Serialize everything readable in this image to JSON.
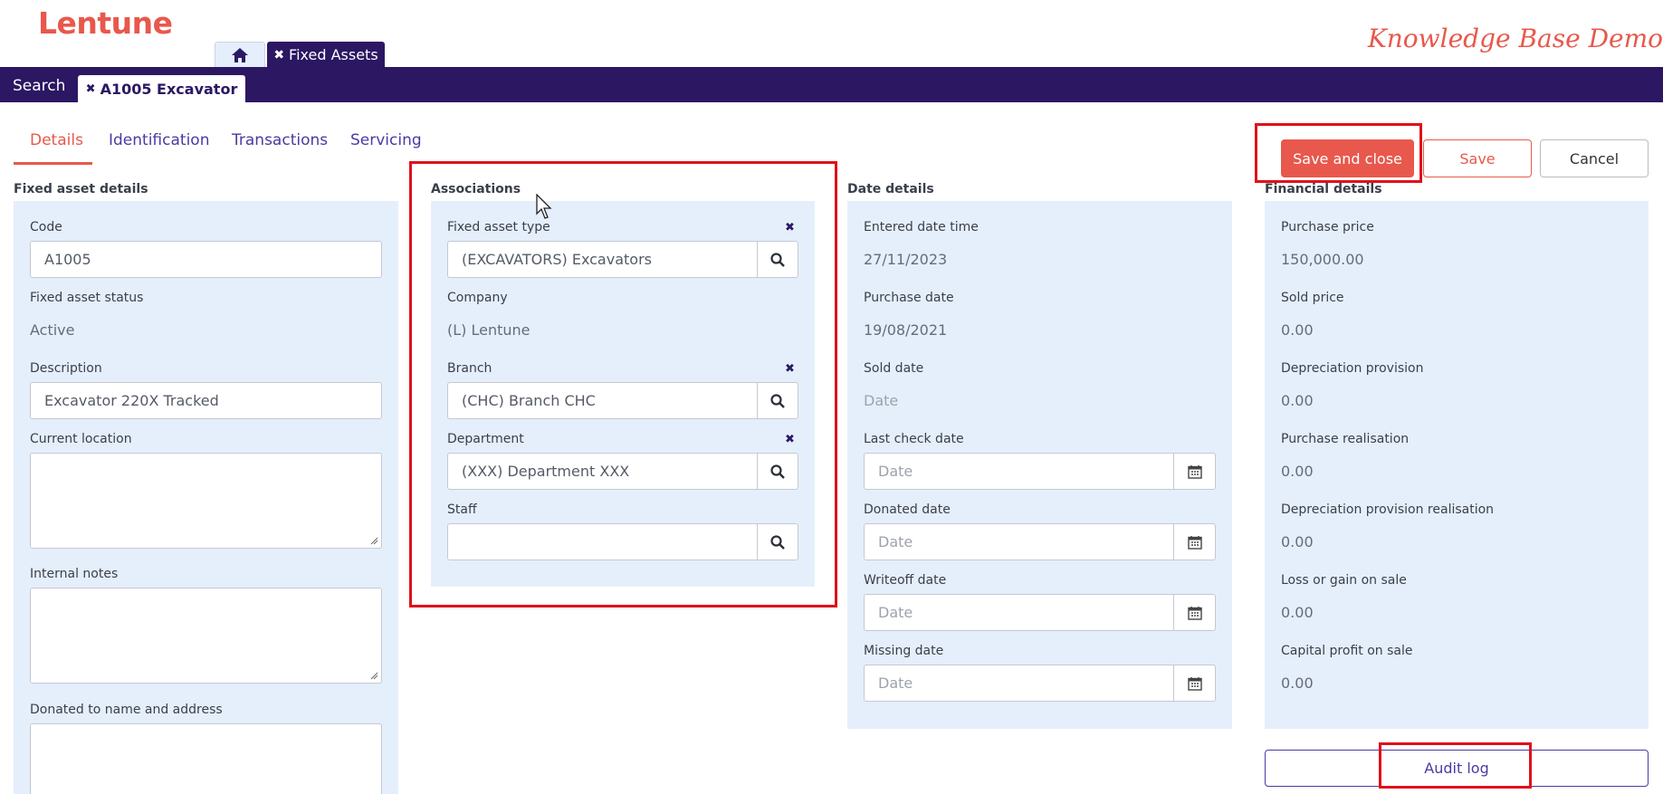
{
  "header": {
    "logo": "Lentune",
    "brand_tagline": "Knowledge Base Demo",
    "top_tabs": [
      {
        "icon": "home-icon"
      },
      {
        "icon": "close-icon",
        "label": "Fixed Assets"
      }
    ]
  },
  "navbar": {
    "search_label": "Search",
    "record_tab_label": "A1005 Excavator"
  },
  "subtabs": {
    "details": "Details",
    "identification": "Identification",
    "transactions": "Transactions",
    "servicing": "Servicing"
  },
  "actions": {
    "save_and_close": "Save and close",
    "save": "Save",
    "cancel": "Cancel",
    "audit_log": "Audit log"
  },
  "fixed_asset_details": {
    "title": "Fixed asset details",
    "code_label": "Code",
    "code_value": "A1005",
    "status_label": "Fixed asset status",
    "status_value": "Active",
    "description_label": "Description",
    "description_value": "Excavator 220X Tracked",
    "location_label": "Current location",
    "notes_label": "Internal notes",
    "donated_to_label": "Donated to name and address"
  },
  "associations": {
    "title": "Associations",
    "type_label": "Fixed asset type",
    "type_value": "(EXCAVATORS) Excavators",
    "company_label": "Company",
    "company_value": "(L) Lentune",
    "branch_label": "Branch",
    "branch_value": "(CHC) Branch CHC",
    "department_label": "Department",
    "department_value": "(XXX) Department XXX",
    "staff_label": "Staff",
    "staff_value": ""
  },
  "date_details": {
    "title": "Date details",
    "entered_label": "Entered date time",
    "entered_value": "27/11/2023",
    "purchase_label": "Purchase date",
    "purchase_value": "19/08/2021",
    "sold_label": "Sold date",
    "sold_value": "Date",
    "last_check_label": "Last check date",
    "donated_label": "Donated date",
    "writeoff_label": "Writeoff date",
    "missing_label": "Missing date",
    "date_placeholder": "Date"
  },
  "financial_details": {
    "title": "Financial details",
    "purchase_price_label": "Purchase price",
    "purchase_price_value": "150,000.00",
    "sold_price_label": "Sold price",
    "sold_price_value": "0.00",
    "dep_provision_label": "Depreciation provision",
    "dep_provision_value": "0.00",
    "purchase_realisation_label": "Purchase realisation",
    "purchase_realisation_value": "0.00",
    "dep_realisation_label": "Depreciation provision realisation",
    "dep_realisation_value": "0.00",
    "loss_gain_label": "Loss or gain on sale",
    "loss_gain_value": "0.00",
    "capital_profit_label": "Capital profit on sale",
    "capital_profit_value": "0.00"
  },
  "colors": {
    "brand": "#e8584c",
    "nav": "#2c1763",
    "panel": "#e5effc",
    "link": "#4a3aa3",
    "highlight": "#e0101a"
  }
}
